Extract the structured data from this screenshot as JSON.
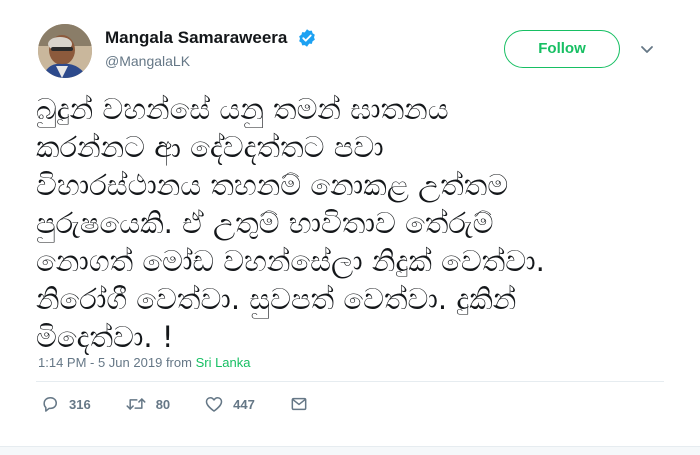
{
  "user": {
    "display_name": "Mangala Samaraweera",
    "handle": "@MangalaLK",
    "verified": true
  },
  "follow_label": "Follow",
  "tweet": {
    "text": "බුදුන් වහන්සේ යනු තමන් ඝාතනය\nකරන්නට ආ දේවදත්තට පවා\nවිහාරස්ථානය තහනම් නොකළ උත්තම\nපුරුෂයෙකි. ඒ උතුම් භාවිතාව තේරුම්\nනොගත් මෝඩ වහන්සේලා නිදුක් වෙත්වා.\nනිරෝගී වෙත්වා.  සුවපත් වෙත්වා. දුකින්\nමිදෙත්වා. !",
    "time": "1:14 PM - 5 Jun 2019",
    "from_label": "from",
    "location": "Sri Lanka"
  },
  "stats": {
    "replies": "316",
    "retweets": "80",
    "likes": "447"
  },
  "colors": {
    "accent_green": "#17bf63",
    "verified_blue": "#1da1f2",
    "muted": "#657786"
  },
  "icons": {
    "reply": "reply-icon",
    "retweet": "retweet-icon",
    "like": "heart-icon",
    "message": "envelope-icon",
    "more": "chevron-down-icon",
    "verified": "verified-badge-icon"
  }
}
